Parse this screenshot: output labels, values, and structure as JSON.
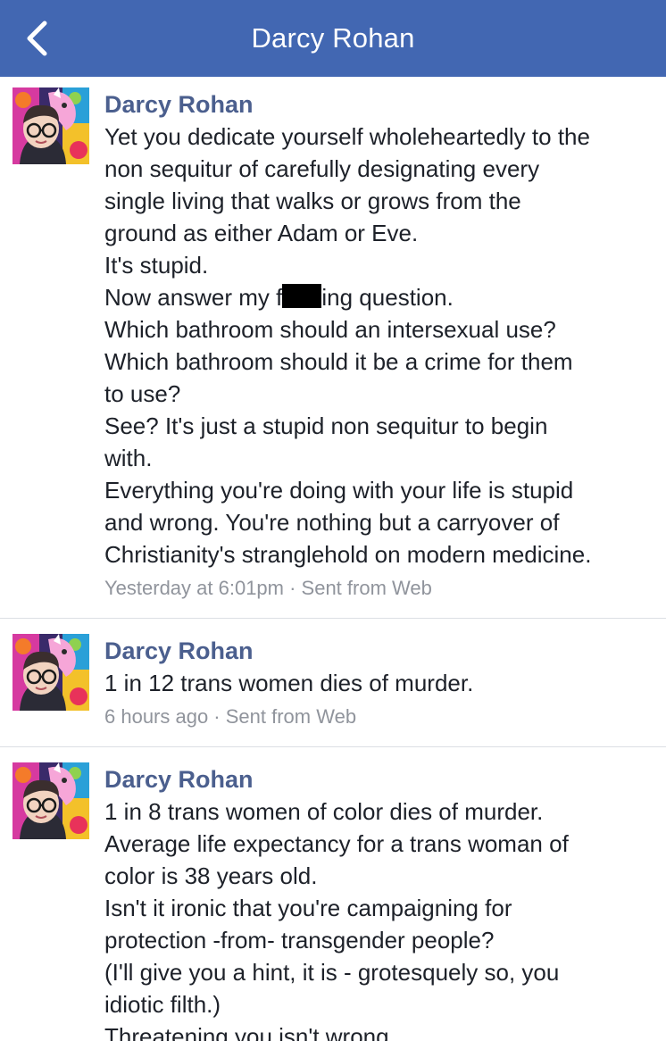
{
  "header": {
    "title": "Darcy Rohan",
    "back_icon": "chevron-left-icon",
    "background": "#4267b2"
  },
  "messages": [
    {
      "sender": "Darcy Rohan",
      "lines": [
        "Yet you dedicate yourself wholeheartedly to the",
        "non sequitur of carefully designating every",
        "single living that walks or grows from the",
        "ground as either Adam or Eve.",
        "It's stupid.",
        "Now answer my f",
        "ing question.",
        "Which bathroom should an intersexual use?",
        "Which bathroom should it be a crime for them",
        "to use?",
        "See? It's just a stupid non sequitur to begin",
        "with.",
        "Everything you're doing with your life is stupid",
        "and wrong. You're nothing but a carryover of",
        "Christianity's stranglehold on modern medicine."
      ],
      "meta": "Yesterday at 6:01pm · Sent from Web"
    },
    {
      "sender": "Darcy Rohan",
      "lines": [
        "1 in 12 trans women dies of murder."
      ],
      "meta": "6 hours ago · Sent from Web"
    },
    {
      "sender": "Darcy Rohan",
      "lines": [
        "1 in 8 trans women of color dies of murder.",
        "Average life expectancy for a trans woman of",
        "color is 38 years old.",
        "Isn't it ironic that you're campaigning for",
        "protection -from- transgender people?",
        "(I'll give you a hint, it is - grotesquely so, you",
        "idiotic filth.)",
        "Threatening you isn't wrong."
      ]
    }
  ]
}
